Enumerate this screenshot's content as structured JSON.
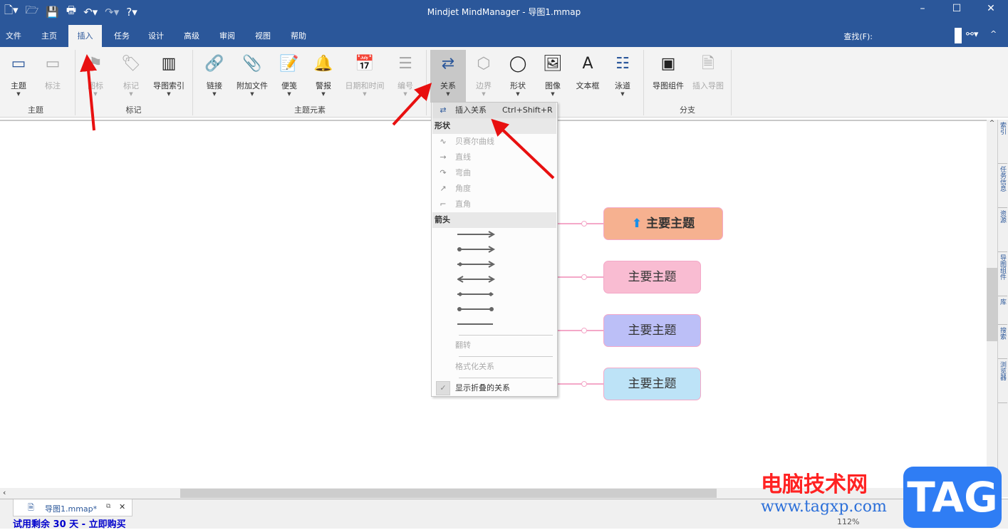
{
  "window": {
    "title": "Mindjet MindManager - 导图1.mmap"
  },
  "ribbon_tabs": [
    "文件",
    "主页",
    "插入",
    "任务",
    "设计",
    "高级",
    "审阅",
    "视图",
    "帮助"
  ],
  "find_label": "查找(F):",
  "ribbon": {
    "buttons": [
      "主题",
      "标注",
      "图标",
      "标记",
      "导图索引",
      "链接",
      "附加文件",
      "便笺",
      "警报",
      "日期和时间",
      "编号",
      "关系",
      "边界",
      "形状",
      "图像",
      "文本框",
      "泳道",
      "导图组件",
      "插入导图"
    ],
    "groups": [
      "主题",
      "标记",
      "主题元素",
      "分支"
    ]
  },
  "menu": {
    "insert_label": "插入关系",
    "insert_shortcut": "Ctrl+Shift+R",
    "shape_header": "形状",
    "shapes": [
      "贝赛尔曲线",
      "直线",
      "弯曲",
      "角度",
      "直角"
    ],
    "arrow_header": "箭头",
    "flip": "翻转",
    "format": "格式化关系",
    "show_collapsed": "显示折叠的关系"
  },
  "topics": [
    {
      "label": "主要主题",
      "color": "#f6b190"
    },
    {
      "label": "主要主题",
      "color": "#f9bcd2"
    },
    {
      "label": "主要主题",
      "color": "#bcbff7"
    },
    {
      "label": "主要主题",
      "color": "#bde3f7"
    }
  ],
  "side_tabs": [
    "索引",
    "任务信息",
    "资源",
    "导图组件",
    "库",
    "搜索",
    "浏览器"
  ],
  "doc_tab": "导图1.mmap*",
  "status": {
    "trial": "试用剩余 30 天 - 立即购买",
    "zoom": "112%"
  },
  "watermark": {
    "cn": "电脑技术网",
    "url": "www.tagxp.com",
    "logo": "TAG"
  }
}
